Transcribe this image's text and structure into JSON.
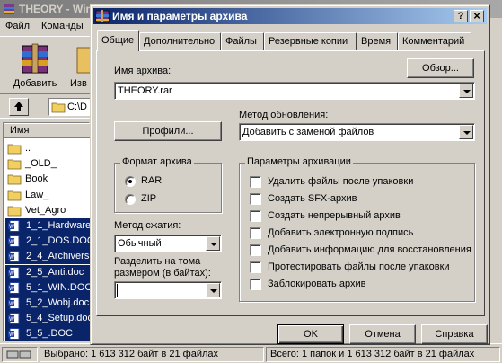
{
  "background": {
    "title": "THEORY - Win",
    "menu": [
      "Файл",
      "Команды"
    ],
    "toolbar": [
      {
        "label": "Добавить",
        "icon": "winrar-add-icon"
      },
      {
        "label": "Изв",
        "icon": "extract-icon"
      }
    ],
    "path_value": "C:\\D",
    "list_header": "Имя",
    "files": [
      {
        "name": "..",
        "type": "folder",
        "selected": false
      },
      {
        "name": "_OLD_",
        "type": "folder",
        "selected": false
      },
      {
        "name": "Book",
        "type": "folder",
        "selected": false
      },
      {
        "name": "Law_",
        "type": "folder",
        "selected": false
      },
      {
        "name": "Vet_Agro",
        "type": "folder",
        "selected": false
      },
      {
        "name": "1_1_Hardware",
        "type": "doc",
        "selected": true
      },
      {
        "name": "2_1_DOS.DOC",
        "type": "doc",
        "selected": true
      },
      {
        "name": "2_4_Archivers",
        "type": "doc",
        "selected": true
      },
      {
        "name": "2_5_Anti.doc",
        "type": "doc",
        "selected": true
      },
      {
        "name": "5_1_WIN.DOC",
        "type": "doc",
        "selected": true
      },
      {
        "name": "5_2_Wobj.doc",
        "type": "doc",
        "selected": true
      },
      {
        "name": "5_4_Setup.doc",
        "type": "doc",
        "selected": true
      },
      {
        "name": "5_5_.DOC",
        "type": "doc",
        "selected": true
      }
    ],
    "status_left": "Выбрано: 1 613 312 байт в 21 файлах",
    "status_right": "Всего: 1 папок и 1 613 312 байт в 21 файлах"
  },
  "dialog": {
    "title": "Имя и параметры архива",
    "help_button": "?",
    "close_button": "×",
    "tabs": [
      "Общие",
      "Дополнительно",
      "Файлы",
      "Резервные копии",
      "Время",
      "Комментарий"
    ],
    "active_tab": "Общие",
    "archive_name_label": "Имя архива:",
    "archive_name_value": "THEORY.rar",
    "browse_button": "Обзор...",
    "profiles_button": "Профили...",
    "update_method_label": "Метод обновления:",
    "update_method_value": "Добавить с заменой файлов",
    "archive_format_group": "Формат архива",
    "format_options": [
      "RAR",
      "ZIP"
    ],
    "format_selected": "RAR",
    "compression_label": "Метод сжатия:",
    "compression_value": "Обычный",
    "split_label_line1": "Разделить на тома",
    "split_label_line2": "размером (в байтах):",
    "split_value": "",
    "archive_options_group": "Параметры архивации",
    "archive_options": [
      {
        "label": "Удалить файлы после упаковки",
        "checked": false
      },
      {
        "label": "Создать SFX-архив",
        "checked": false
      },
      {
        "label": "Создать непрерывный архив",
        "checked": false
      },
      {
        "label": "Добавить электронную подпись",
        "checked": false
      },
      {
        "label": "Добавить информацию для восстановления",
        "checked": false
      },
      {
        "label": "Протестировать файлы после упаковки",
        "checked": false
      },
      {
        "label": "Заблокировать архив",
        "checked": false
      }
    ],
    "ok_button": "OK",
    "cancel_button": "Отмена",
    "help_bottom_button": "Справка"
  }
}
